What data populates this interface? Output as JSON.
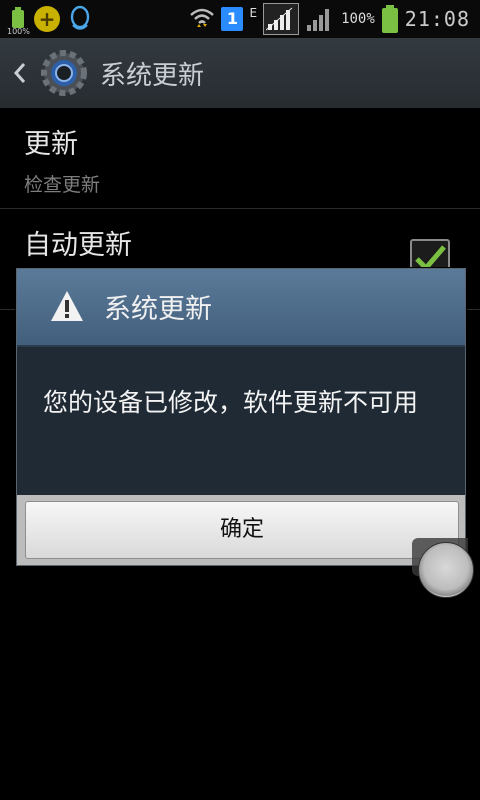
{
  "status_bar": {
    "battery_small_label": "100%",
    "sim_label": "1",
    "network_type": "E",
    "battery_percent": "100%",
    "time": "21:08"
  },
  "action_bar": {
    "title": "系统更新"
  },
  "list": {
    "update": {
      "title": "更新",
      "summary": "检查更新"
    },
    "auto_update": {
      "title": "自动更新",
      "checked": true
    }
  },
  "dialog": {
    "title": "系统更新",
    "message": "您的设备已修改，软件更新不可用",
    "ok_label": "确定"
  },
  "colors": {
    "accent_green": "#7bc043",
    "dialog_header": "#4f6f8f",
    "dialog_body": "#1f2a35"
  }
}
